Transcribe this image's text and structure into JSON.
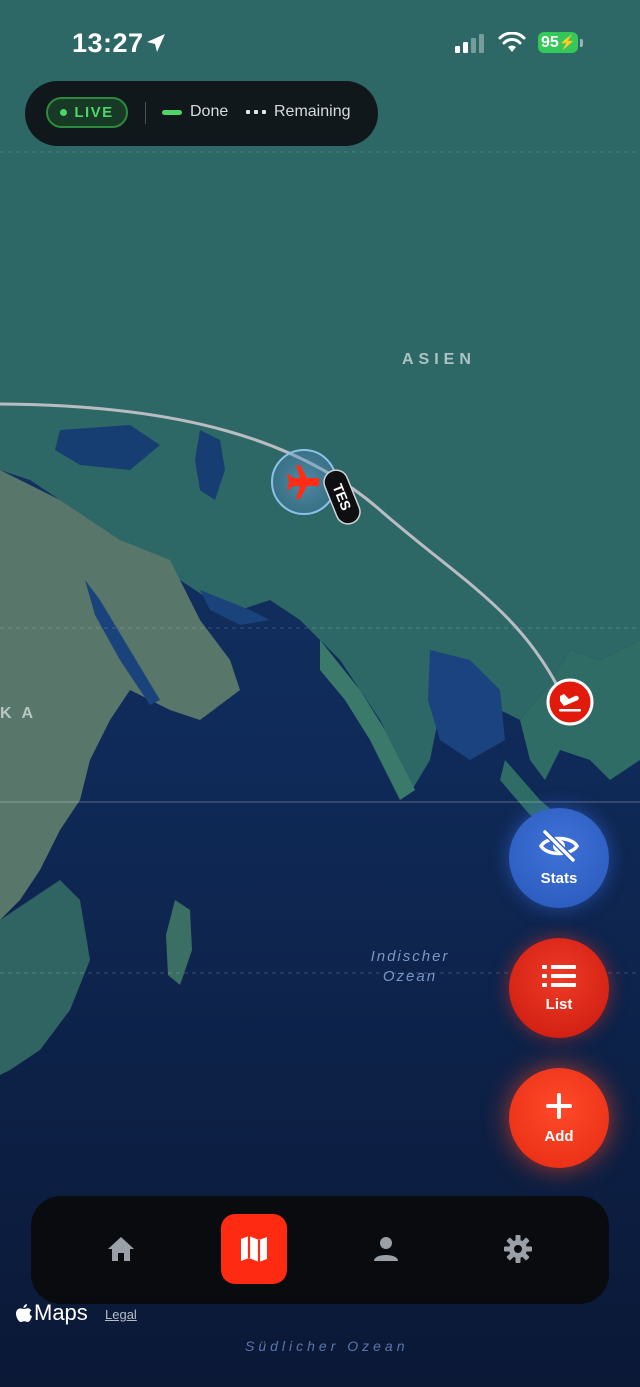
{
  "status_bar": {
    "time": "13:27",
    "battery": "95",
    "battery_color": "#34c759",
    "icons": [
      "location-arrow-icon",
      "cellular-signal-icon",
      "wifi-icon",
      "battery-charging-icon"
    ]
  },
  "legend": {
    "live_label": "LIVE",
    "done_label": "Done",
    "remaining_label": "Remaining",
    "done_color": "#4fd466"
  },
  "map": {
    "labels": {
      "continent_asia": "ASIEN",
      "continent_africa_partial": "KA",
      "ocean_indian_line1": "Indischer",
      "ocean_indian_line2": "Ozean",
      "ocean_southern": "Südlicher Ozean"
    },
    "flight_tag": "TES",
    "icons": [
      "airplane-icon",
      "airplane-landing-icon"
    ]
  },
  "actions": {
    "stats_label": "Stats",
    "list_label": "List",
    "add_label": "Add",
    "icons": [
      "eye-slash-icon",
      "list-icon",
      "plus-icon"
    ]
  },
  "tabbar": {
    "active_tab": "map",
    "accent_color": "#ff2a12",
    "icons": [
      "home-icon",
      "map-icon",
      "person-icon",
      "gear-icon"
    ]
  },
  "attribution": {
    "maps_label": "Maps",
    "legal_label": "Legal"
  }
}
